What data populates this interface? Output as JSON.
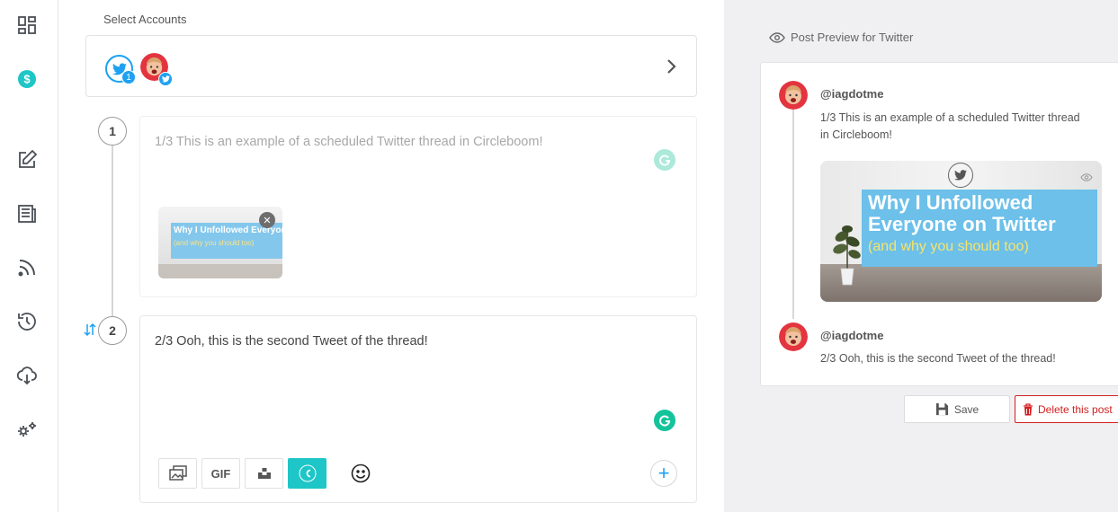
{
  "sidebar": {
    "icons": [
      "dashboard-icon",
      "dollar-icon",
      "compose-icon",
      "articles-icon",
      "rss-icon",
      "history-icon",
      "cloud-download-icon",
      "settings-icon"
    ]
  },
  "accounts": {
    "label": "Select Accounts",
    "twitter_count": "1"
  },
  "thread": {
    "tweets": [
      {
        "number": "1",
        "text": "1/3 This is an example of a scheduled Twitter thread in Circleboom!",
        "attachment": {
          "title": "Why I Unfollowed Everyone on Twitter",
          "subtitle": "(and why you should too)"
        }
      },
      {
        "number": "2",
        "text": "2/3 Ooh, this is the second Tweet of the thread!"
      }
    ],
    "toolbar": {
      "gif_label": "GIF"
    }
  },
  "preview": {
    "label": "Post Preview for Twitter",
    "posts": [
      {
        "handle": "@iagdotme",
        "text": "1/3 This is an example of a scheduled Twitter thread in Circleboom!",
        "image_title": "Why I Unfollowed Everyone on Twitter",
        "image_subtitle": "(and why you should too)"
      },
      {
        "handle": "@iagdotme",
        "text": "2/3 Ooh, this is the second Tweet of the thread!"
      }
    ],
    "save_label": "Save",
    "delete_label": "Delete this post"
  },
  "colors": {
    "twitter": "#1da1f2",
    "accent": "#1ec6c7",
    "grammarly": "#15c39a",
    "danger": "#d21f1f"
  }
}
